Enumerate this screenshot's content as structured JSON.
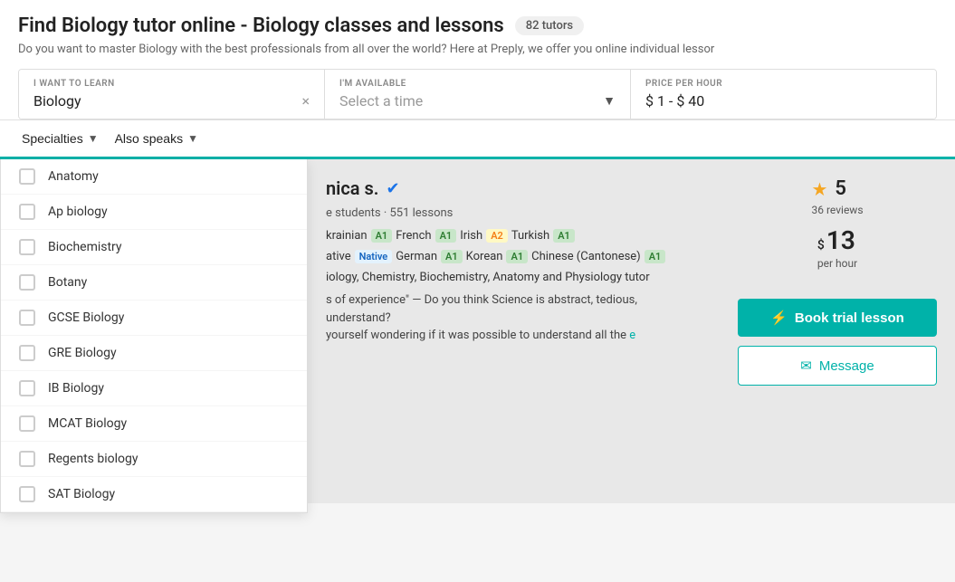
{
  "page": {
    "title": "Find Biology tutor online - Biology classes and lessons",
    "tutor_count": "82 tutors",
    "subtitle": "Do you want to master Biology with the best professionals from all over the world? Here at Preply, we offer you online individual lessor"
  },
  "filters": {
    "want_to_learn_label": "I WANT TO LEARN",
    "want_to_learn_value": "Biology",
    "available_label": "I'M AVAILABLE",
    "available_placeholder": "Select a time",
    "price_label": "PRICE PER HOUR",
    "price_value": "$ 1 - $ 40"
  },
  "specialties_btn": "Specialties",
  "also_speaks_btn": "Also speaks",
  "dropdown": {
    "items": [
      "Anatomy",
      "Ap biology",
      "Biochemistry",
      "Botany",
      "GCSE Biology",
      "GRE Biology",
      "IB Biology",
      "MCAT Biology",
      "Regents biology",
      "SAT Biology"
    ]
  },
  "tutor": {
    "name": "nica s.",
    "stats": "e students · 551 lessons",
    "languages": [
      {
        "name": "krainian",
        "level": "A1"
      },
      {
        "name": "French",
        "level": "A1"
      },
      {
        "name": "Irish",
        "level": "A2"
      },
      {
        "name": "Turkish",
        "level": "A1"
      },
      {
        "name": "ative",
        "level": "native"
      },
      {
        "name": "German",
        "level": "A1"
      },
      {
        "name": "Korean",
        "level": "A1"
      },
      {
        "name": "Chinese (Cantonese)",
        "level": "A1"
      }
    ],
    "subjects": "iology, Chemistry, Biochemistry, Anatomy and Physiology tutor",
    "description_1": "s of experience\" — Do you think Science is abstract, tedious,",
    "description_2": "understand?",
    "description_3": "yourself wondering if it was possible to understand all the",
    "read_more": "e",
    "rating": "5",
    "reviews_count": "36",
    "reviews_label": "reviews",
    "price": "13",
    "price_currency": "$",
    "per_hour": "per hour",
    "btn_trial": "Book trial lesson",
    "btn_message": "Message"
  }
}
